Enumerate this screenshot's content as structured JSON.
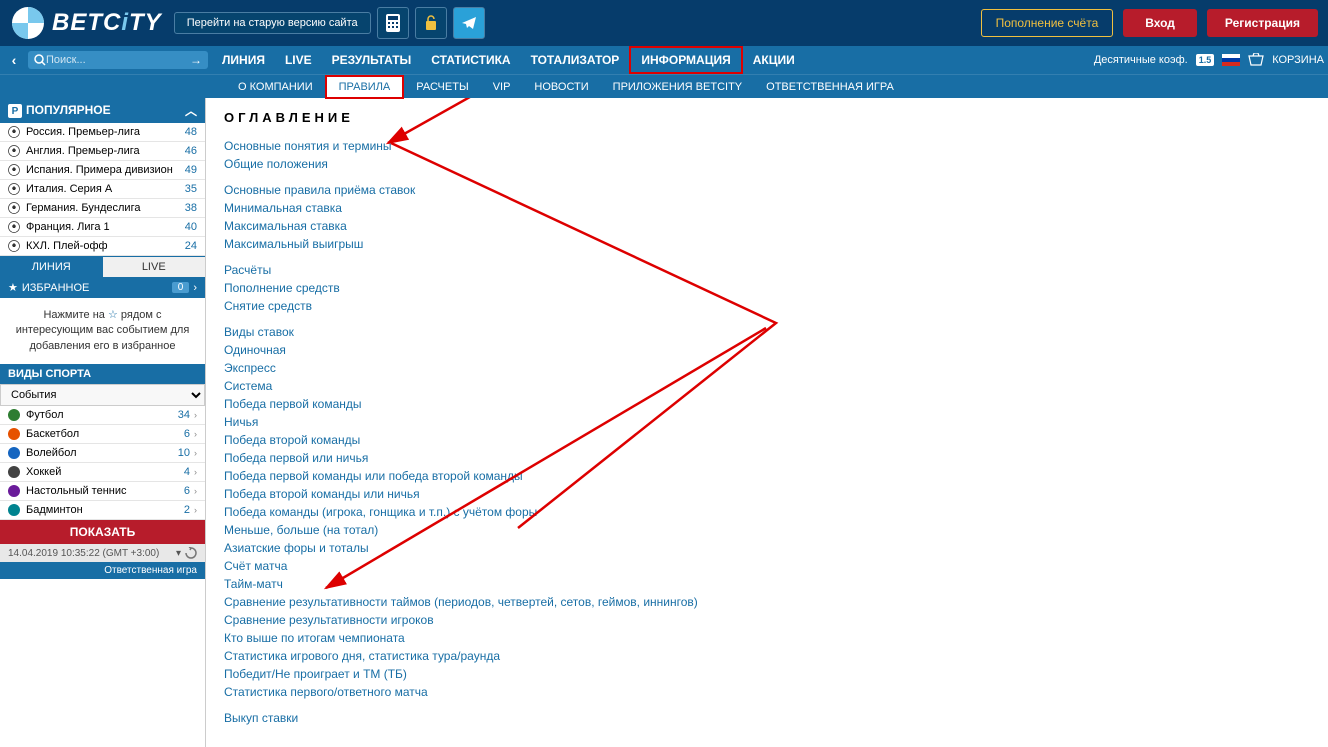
{
  "header": {
    "logo_text_pre": "BETC",
    "logo_text_i": "i",
    "logo_text_post": "TY",
    "old_version_btn": "Перейти на старую версию сайта",
    "balance_btn": "Пополнение счёта",
    "login_btn": "Вход",
    "register_btn": "Регистрация"
  },
  "nav": {
    "search_placeholder": "Поиск...",
    "items": [
      "ЛИНИЯ",
      "LIVE",
      "РЕЗУЛЬТАТЫ",
      "СТАТИСТИКА",
      "ТОТАЛИЗАТОР",
      "ИНФОРМАЦИЯ",
      "АКЦИИ"
    ],
    "coef_label": "Десятичные коэф.",
    "coef_val": "1.5",
    "basket": "КОРЗИНА"
  },
  "subnav": {
    "items": [
      "О КОМПАНИИ",
      "ПРАВИЛА",
      "РАСЧЕТЫ",
      "VIP",
      "НОВОСТИ",
      "ПРИЛОЖЕНИЯ BETCITY",
      "ОТВЕТСТВЕННАЯ ИГРА"
    ]
  },
  "popular": {
    "title": "ПОПУЛЯРНОЕ",
    "items": [
      {
        "label": "Россия. Премьер-лига",
        "cnt": "48"
      },
      {
        "label": "Англия. Премьер-лига",
        "cnt": "46"
      },
      {
        "label": "Испания. Примера дивизион",
        "cnt": "49"
      },
      {
        "label": "Италия. Серия А",
        "cnt": "35"
      },
      {
        "label": "Германия. Бундеслига",
        "cnt": "38"
      },
      {
        "label": "Франция. Лига 1",
        "cnt": "40"
      },
      {
        "label": "КХЛ. Плей-офф",
        "cnt": "24"
      }
    ]
  },
  "lf_tabs": {
    "line": "ЛИНИЯ",
    "live": "LIVE"
  },
  "favorites": {
    "title": "ИЗБРАННОЕ",
    "count": "0",
    "hint_pre": "Нажмите на ",
    "hint_post": " рядом с интересующим вас событием для добавления его в избранное"
  },
  "sports": {
    "header": "ВИДЫ СПОРТА",
    "select": "События",
    "items": [
      {
        "label": "Футбол",
        "cnt": "34",
        "color": "#2e7d32"
      },
      {
        "label": "Баскетбол",
        "cnt": "6",
        "color": "#e65100"
      },
      {
        "label": "Волейбол",
        "cnt": "10",
        "color": "#1565c0"
      },
      {
        "label": "Хоккей",
        "cnt": "4",
        "color": "#424242"
      },
      {
        "label": "Настольный теннис",
        "cnt": "6",
        "color": "#6a1b9a"
      },
      {
        "label": "Бадминтон",
        "cnt": "2",
        "color": "#00838f"
      }
    ],
    "show_btn": "ПОКАЗАТЬ",
    "datetime": "14.04.2019 10:35:22 (GMT +3:00)",
    "responsible": "Ответственная игра"
  },
  "toc": {
    "title": "ОГЛАВЛЕНИЕ",
    "groups": [
      [
        "Основные понятия и термины",
        "Общие положения"
      ],
      [
        "Основные правила приёма ставок",
        "Минимальная ставка",
        "Максимальная ставка",
        "Максимальный выигрыш"
      ],
      [
        "Расчёты",
        "Пополнение средств",
        "Снятие средств"
      ],
      [
        "Виды ставок",
        "Одиночная",
        "Экспресс",
        "Система",
        "Победа первой команды",
        "Ничья",
        "Победа второй команды",
        "Победа первой или ничья",
        "Победа первой команды или победа второй команды",
        "Победа второй команды или ничья",
        "Победа команды (игрока, гонщика и т.п.) с учётом форы",
        "Меньше, больше (на тотал)",
        "Азиатские форы и тоталы",
        "Счёт матча",
        "Тайм-матч",
        "Сравнение результативности таймов (периодов, четвертей, сетов, геймов, иннингов)",
        "Сравнение результативности игроков",
        "Кто выше по итогам чемпионата",
        "Статистика игрового дня, статистика тура/раунда",
        "Победит/Не проиграет и ТМ (ТБ)",
        "Статистика первого/ответного матча"
      ],
      [
        "Выкуп ставки"
      ]
    ]
  }
}
